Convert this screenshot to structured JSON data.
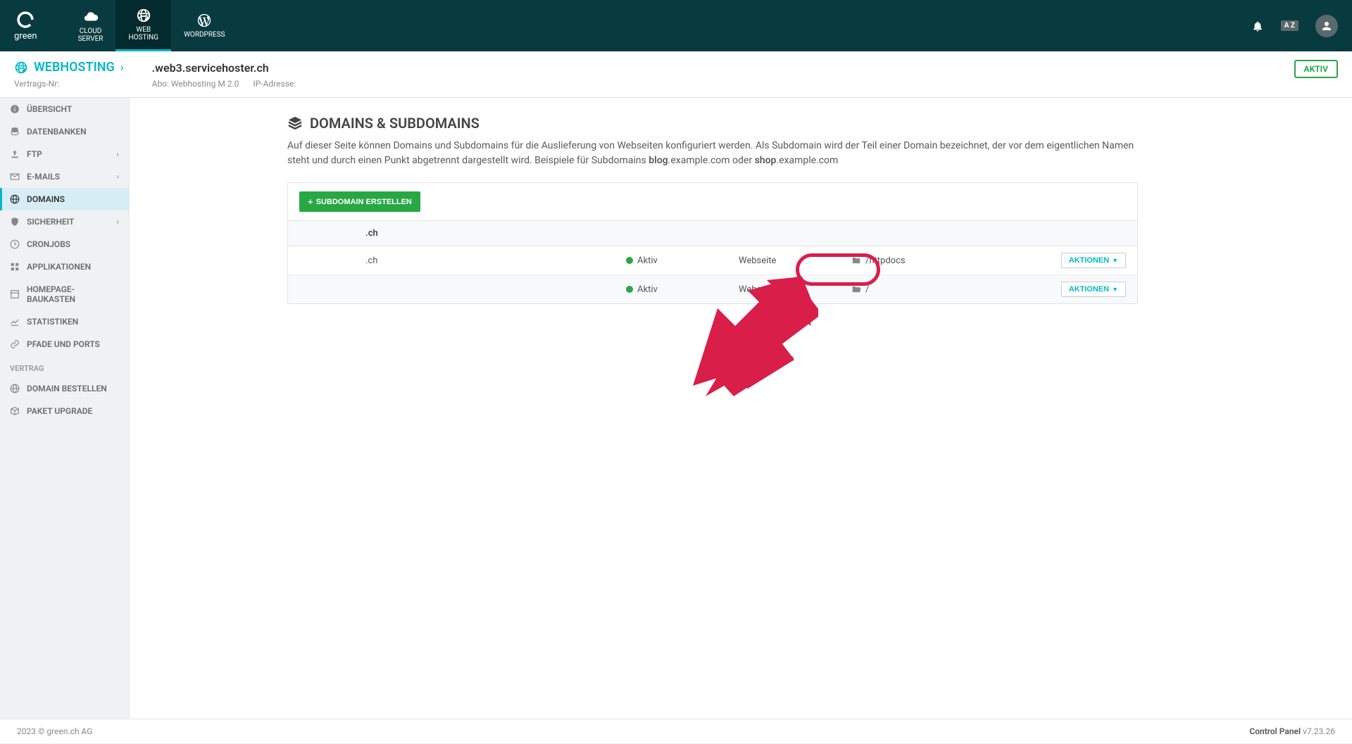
{
  "brand": {
    "name": "green"
  },
  "topnav": {
    "items": [
      {
        "label_l1": "CLOUD",
        "label_l2": "SERVER",
        "icon": "cloud"
      },
      {
        "label_l1": "WEB",
        "label_l2": "HOSTING",
        "icon": "globe",
        "active": true
      },
      {
        "label_l1": "WORDPRESS",
        "label_l2": "",
        "icon": "wordpress"
      }
    ],
    "lang": "A Z"
  },
  "breadcrumb": {
    "title": "WEBHOSTING",
    "contract_label": "Vertrags-Nr:",
    "hostname": ".web3.servicehoster.ch",
    "abo_label": "Abo:",
    "abo_value": "Webhosting M 2.0",
    "ip_label": "IP-Adresse:",
    "status": "AKTIV"
  },
  "sidebar": {
    "items": [
      {
        "label": "ÜBERSICHT",
        "icon": "info"
      },
      {
        "label": "DATENBANKEN",
        "icon": "database"
      },
      {
        "label": "FTP",
        "icon": "upload",
        "chevron": true
      },
      {
        "label": "E-MAILS",
        "icon": "mail",
        "chevron": true
      },
      {
        "label": "DOMAINS",
        "icon": "globe2",
        "active": true
      },
      {
        "label": "SICHERHEIT",
        "icon": "shield",
        "chevron": true
      },
      {
        "label": "CRONJOBS",
        "icon": "clock"
      },
      {
        "label": "APPLIKATIONEN",
        "icon": "apps"
      },
      {
        "label": "HOMEPAGE-BAUKASTEN",
        "icon": "layout"
      },
      {
        "label": "STATISTIKEN",
        "icon": "chart"
      },
      {
        "label": "PFADE UND PORTS",
        "icon": "link"
      }
    ],
    "section_label": "VERTRAG",
    "items2": [
      {
        "label": "DOMAIN BESTELLEN",
        "icon": "globe2"
      },
      {
        "label": "PAKET UPGRADE",
        "icon": "box"
      }
    ]
  },
  "page": {
    "title": "DOMAINS & SUBDOMAINS",
    "desc_part1": "Auf dieser Seite können Domains und Subdomains für die Auslieferung von Webseiten konfiguriert werden. Als Subdomain wird der Teil einer Domain bezeichnet, der vor dem eigentlichen Namen steht und durch einen Punkt abgetrennt dargestellt wird. Beispiele für Subdomains ",
    "desc_bold1": "blog",
    "desc_mid1": ".example.com oder ",
    "desc_bold2": "shop",
    "desc_mid2": ".example.com",
    "create_button": "SUBDOMAIN ERSTELLEN",
    "group_header": ".ch",
    "rows": [
      {
        "name": ".ch",
        "status": "Aktiv",
        "type": "Webseite",
        "path": "/httpdocs",
        "action": "AKTIONEN"
      },
      {
        "name": "",
        "status": "Aktiv",
        "type": "Webseite",
        "path": "/",
        "action": "AKTIONEN"
      }
    ]
  },
  "footer": {
    "copyright": "2023 © green.ch AG",
    "cp_label": "Control Panel",
    "cp_version": "v7.23.26"
  },
  "annotation": {
    "color": "#d91e4a"
  }
}
